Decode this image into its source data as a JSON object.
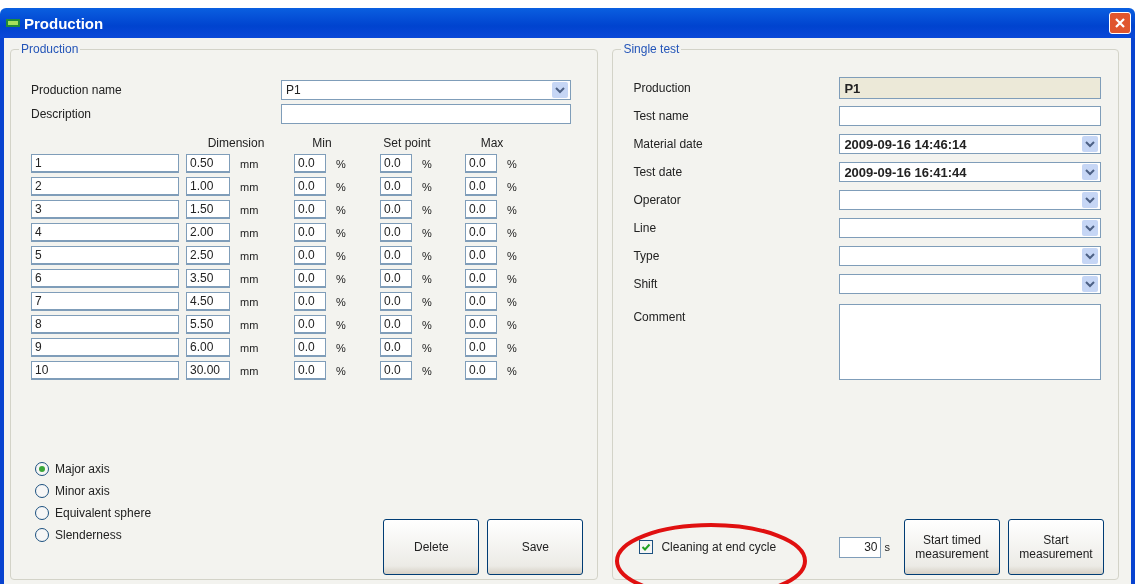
{
  "window": {
    "title": "Production"
  },
  "production_group": {
    "title": "Production",
    "fields": [
      {
        "label": "Production name",
        "value": "P1",
        "kind": "dropdown"
      },
      {
        "label": "Description",
        "kind": "text"
      }
    ],
    "columns": [
      "Dimension",
      "Min",
      "Set point",
      "Max"
    ],
    "rows": [
      {
        "name": "1",
        "dimension": "0.50",
        "dimension_unit": "mm",
        "min": "0.0",
        "min_unit": "%",
        "set_point": "0.0",
        "set_point_unit": "%",
        "max": "0.0",
        "max_unit": "%"
      },
      {
        "name": "2",
        "dimension": "1.00",
        "dimension_unit": "mm",
        "min": "0.0",
        "min_unit": "%",
        "set_point": "0.0",
        "set_point_unit": "%",
        "max": "0.0",
        "max_unit": "%"
      },
      {
        "name": "3",
        "dimension": "1.50",
        "dimension_unit": "mm",
        "min": "0.0",
        "min_unit": "%",
        "set_point": "0.0",
        "set_point_unit": "%",
        "max": "0.0",
        "max_unit": "%"
      },
      {
        "name": "4",
        "dimension": "2.00",
        "dimension_unit": "mm",
        "min": "0.0",
        "min_unit": "%",
        "set_point": "0.0",
        "set_point_unit": "%",
        "max": "0.0",
        "max_unit": "%"
      },
      {
        "name": "5",
        "dimension": "2.50",
        "dimension_unit": "mm",
        "min": "0.0",
        "min_unit": "%",
        "set_point": "0.0",
        "set_point_unit": "%",
        "max": "0.0",
        "max_unit": "%"
      },
      {
        "name": "6",
        "dimension": "3.50",
        "dimension_unit": "mm",
        "min": "0.0",
        "min_unit": "%",
        "set_point": "0.0",
        "set_point_unit": "%",
        "max": "0.0",
        "max_unit": "%"
      },
      {
        "name": "7",
        "dimension": "4.50",
        "dimension_unit": "mm",
        "min": "0.0",
        "min_unit": "%",
        "set_point": "0.0",
        "set_point_unit": "%",
        "max": "0.0",
        "max_unit": "%"
      },
      {
        "name": "8",
        "dimension": "5.50",
        "dimension_unit": "mm",
        "min": "0.0",
        "min_unit": "%",
        "set_point": "0.0",
        "set_point_unit": "%",
        "max": "0.0",
        "max_unit": "%"
      },
      {
        "name": "9",
        "dimension": "6.00",
        "dimension_unit": "mm",
        "min": "0.0",
        "min_unit": "%",
        "set_point": "0.0",
        "set_point_unit": "%",
        "max": "0.0",
        "max_unit": "%"
      },
      {
        "name": "10",
        "dimension": "30.00",
        "dimension_unit": "mm",
        "min": "0.0",
        "min_unit": "%",
        "set_point": "0.0",
        "set_point_unit": "%",
        "max": "0.0",
        "max_unit": "%"
      }
    ],
    "axis_options": [
      {
        "label": "Major axis",
        "selected": true
      },
      {
        "label": "Minor axis",
        "selected": false
      },
      {
        "label": "Equivalent sphere",
        "selected": false
      },
      {
        "label": "Slenderness",
        "selected": false
      }
    ],
    "buttons": [
      "Delete",
      "Save"
    ]
  },
  "single_test": {
    "title": "Single test",
    "fields": [
      {
        "label": "Production",
        "value": "P1",
        "kind": "readonly"
      },
      {
        "label": "Test name",
        "kind": "text"
      },
      {
        "label": "Material date",
        "value": "2009-09-16 14:46:14",
        "kind": "dropdown"
      },
      {
        "label": "Test date",
        "value": "2009-09-16 16:41:44",
        "kind": "dropdown"
      },
      {
        "label": "Operator",
        "kind": "dropdown"
      },
      {
        "label": "Line",
        "kind": "dropdown"
      },
      {
        "label": "Type",
        "kind": "dropdown"
      },
      {
        "label": "Shift",
        "kind": "dropdown"
      },
      {
        "label": "Comment",
        "kind": "multiline"
      }
    ],
    "cleaning": {
      "label": "Cleaning at end cycle",
      "checked": true
    },
    "timer": {
      "value": "30",
      "unit": "s"
    },
    "buttons": [
      "Start timed measurement",
      "Start measurement"
    ]
  }
}
